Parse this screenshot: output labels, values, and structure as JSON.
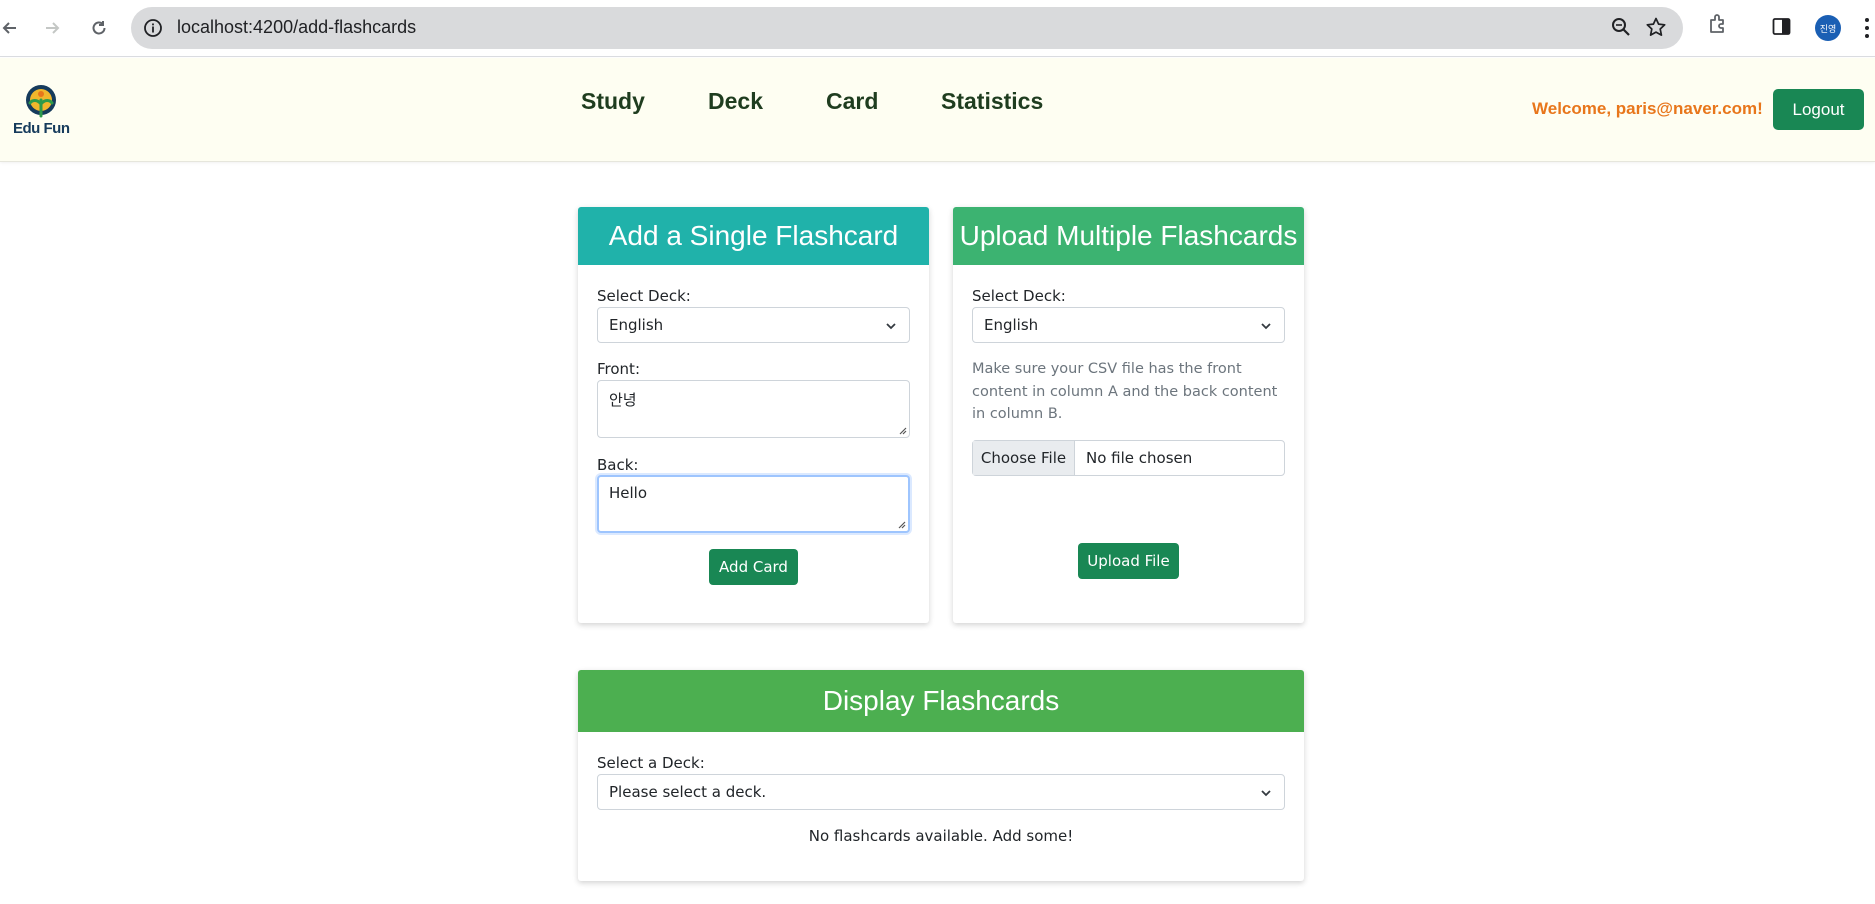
{
  "browser": {
    "url": "localhost:4200/add-flashcards",
    "profile_initials": "진영"
  },
  "header": {
    "logo_text": "Edu Fun",
    "nav": [
      "Study",
      "Deck",
      "Card",
      "Statistics"
    ],
    "welcome": "Welcome, paris@naver.com!",
    "logout_label": "Logout"
  },
  "single": {
    "title": "Add a Single Flashcard",
    "deck_label": "Select Deck:",
    "deck_value": "English",
    "front_label": "Front:",
    "front_value": "안녕",
    "back_label": "Back:",
    "back_value": "Hello",
    "add_label": "Add Card",
    "head_color": "#20b2aa"
  },
  "upload": {
    "title": "Upload Multiple Flashcards",
    "deck_label": "Select Deck:",
    "deck_value": "English",
    "hint": "Make sure your CSV file has the front content in column A and the back content in column B.",
    "choose_label": "Choose File",
    "file_status": "No file chosen",
    "upload_label": "Upload File",
    "head_color": "#3cb371"
  },
  "display": {
    "title": "Display Flashcards",
    "deck_label": "Select a Deck:",
    "deck_placeholder": "Please select a deck.",
    "empty_message": "No flashcards available. Add some!",
    "head_color": "#4caf50"
  }
}
